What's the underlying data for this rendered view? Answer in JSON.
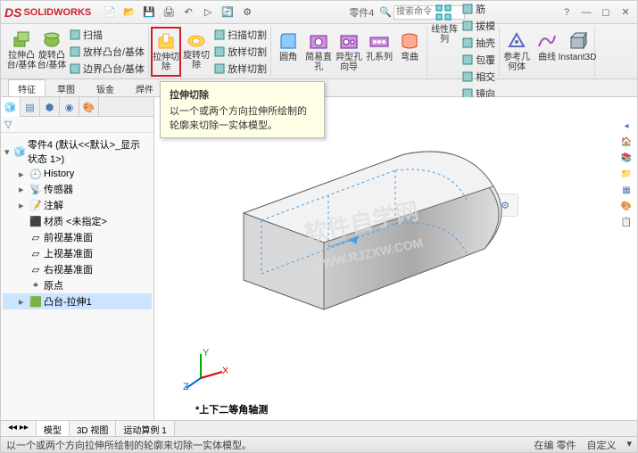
{
  "app": {
    "name": "SOLIDWORKS",
    "logo_prefix": "DS"
  },
  "titlebar": {
    "doc": "零件4",
    "search_placeholder": "搜索命令"
  },
  "ribbon": {
    "groups": [
      {
        "big": [
          {
            "id": "extrude-boss",
            "label": "拉伸凸\n台/基体"
          },
          {
            "id": "revolve-boss",
            "label": "旋转凸\n台/基体"
          }
        ],
        "small": [
          {
            "id": "sweep",
            "label": "扫描"
          },
          {
            "id": "loft",
            "label": "放样凸台/基体"
          },
          {
            "id": "boundary",
            "label": "边界凸台/基体"
          }
        ]
      },
      {
        "big": [
          {
            "id": "extrude-cut",
            "label": "拉伸切\n除",
            "hl": true
          },
          {
            "id": "revolve-cut",
            "label": "旋转切\n除"
          }
        ],
        "small": [
          {
            "id": "sweep-cut",
            "label": "扫描切割"
          },
          {
            "id": "loft-cut",
            "label": "放样切割"
          },
          {
            "id": "boundary-cut",
            "label": "放样切割"
          }
        ]
      },
      {
        "big": [
          {
            "id": "fillet",
            "label": "圆角"
          },
          {
            "id": "hole-simple",
            "label": "简易直\n孔"
          },
          {
            "id": "hole-wizard",
            "label": "异型孔\n向导"
          },
          {
            "id": "hole-series",
            "label": "孔系列"
          },
          {
            "id": "wrap",
            "label": "弯曲"
          }
        ],
        "small": []
      },
      {
        "big": [
          {
            "id": "linear-pattern",
            "label": "线性阵\n列"
          }
        ],
        "small": [
          {
            "id": "rib",
            "label": "筋"
          },
          {
            "id": "draft",
            "label": "拔模"
          },
          {
            "id": "shell",
            "label": "抽壳"
          },
          {
            "id": "wrap2",
            "label": "包覆"
          },
          {
            "id": "intersect",
            "label": "相交"
          },
          {
            "id": "mirror",
            "label": "镜向"
          }
        ]
      },
      {
        "big": [
          {
            "id": "ref-geom",
            "label": "参考几\n何体"
          },
          {
            "id": "curves",
            "label": "曲线"
          },
          {
            "id": "instant3d",
            "label": "Instant3D"
          }
        ],
        "small": []
      }
    ]
  },
  "tabs": [
    "特征",
    "草图",
    "钣金",
    "焊件"
  ],
  "active_tab": 0,
  "tooltip": {
    "title": "拉伸切除",
    "body": "以一个或两个方向拉伸所绘制的轮廓来切除一实体模型。"
  },
  "tree": {
    "root": "零件4 (默认<<默认>_显示状态 1>)",
    "nodes": [
      {
        "icon": "history",
        "label": "History"
      },
      {
        "icon": "sensor",
        "label": "传感器"
      },
      {
        "icon": "annot",
        "label": "注解"
      },
      {
        "icon": "material",
        "label": "材质 <未指定>"
      },
      {
        "icon": "plane",
        "label": "前视基准面"
      },
      {
        "icon": "plane",
        "label": "上视基准面"
      },
      {
        "icon": "plane",
        "label": "右视基准面"
      },
      {
        "icon": "origin",
        "label": "原点"
      },
      {
        "icon": "feature",
        "label": "凸台-拉伸1",
        "selected": true
      }
    ]
  },
  "orientation": "*上下二等角轴测",
  "bottom_tabs": [
    "模型",
    "3D 视图",
    "运动算例 1"
  ],
  "statusbar": {
    "msg": "以一个或两个方向拉伸所绘制的轮廓来切除一实体模型。",
    "right": [
      "在编 零件",
      "自定义"
    ]
  },
  "chart_data": null
}
